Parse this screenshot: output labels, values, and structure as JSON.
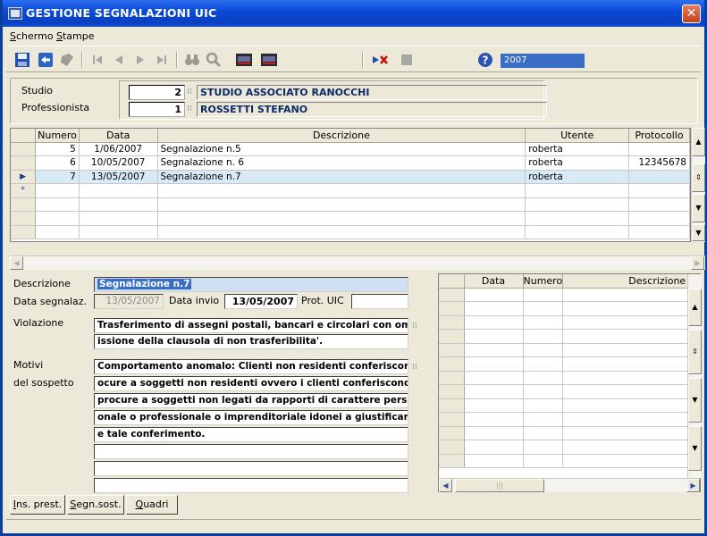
{
  "window": {
    "title": "GESTIONE SEGNALAZIONI UIC",
    "close_label": "✕"
  },
  "menu": [
    "Schermo",
    "Stampe"
  ],
  "toolbar": {
    "year": "2007"
  },
  "header": {
    "studio_label": "Studio",
    "studio_code": "2",
    "studio_name": "STUDIO ASSOCIATO RANOCCHI",
    "prof_label": "Professionista",
    "prof_code": "1",
    "prof_name": "ROSSETTI STEFANO"
  },
  "grid": {
    "columns": [
      "Numero",
      "Data",
      "Descrizione",
      "Utente",
      "Protocollo"
    ],
    "rows": [
      {
        "indicator": "",
        "numero": "5",
        "data": "1/06/2007",
        "descrizione": "Segnalazione n.5",
        "utente": "roberta",
        "protocollo": ""
      },
      {
        "indicator": "",
        "numero": "6",
        "data": "10/05/2007",
        "descrizione": "Segnalazione n. 6",
        "utente": "roberta",
        "protocollo": "12345678"
      },
      {
        "indicator": "▶",
        "numero": "7",
        "data": "13/05/2007",
        "descrizione": "Segnalazione n.7",
        "utente": "roberta",
        "protocollo": ""
      },
      {
        "indicator": "*",
        "numero": "",
        "data": "",
        "descrizione": "",
        "utente": "",
        "protocollo": ""
      }
    ]
  },
  "detail": {
    "descrizione_label": "Descrizione",
    "descrizione_value": "Segnalazione n.7",
    "data_segnalaz_label": "Data segnalaz.",
    "data_segnalaz_value": "13/05/2007",
    "data_invio_label": "Data invio",
    "data_invio_value": "13/05/2007",
    "prot_uic_label": "Prot. UIC",
    "prot_uic_value": "",
    "violazione_label": "Violazione",
    "violazione_lines": [
      "Trasferimento di assegni postali, bancari e circolari con om",
      "issione della clausola di non trasferibilita'."
    ],
    "motivi_label": "Motivi",
    "sospetto_label": "del sospetto",
    "motivi_lines": [
      "Comportamento anomalo: Clienti non residenti conferiscono pr",
      "ocure a soggetti non residenti ovvero i clienti conferiscono",
      " procure a soggetti non legati da rapporti di carattere pers",
      "onale o professionale o imprenditoriale idonei a giustificar",
      "e tale conferimento.",
      "",
      "",
      ""
    ]
  },
  "grid2": {
    "columns": [
      "Data",
      "Numero",
      "Descrizione"
    ]
  },
  "tabs": [
    "Ins. prest.",
    "Segn.sost.",
    "Quadri"
  ],
  "colors": {
    "titlebar": "#0a4bd8",
    "selection": "#d8eaf6",
    "name_text": "#0b2a67"
  }
}
